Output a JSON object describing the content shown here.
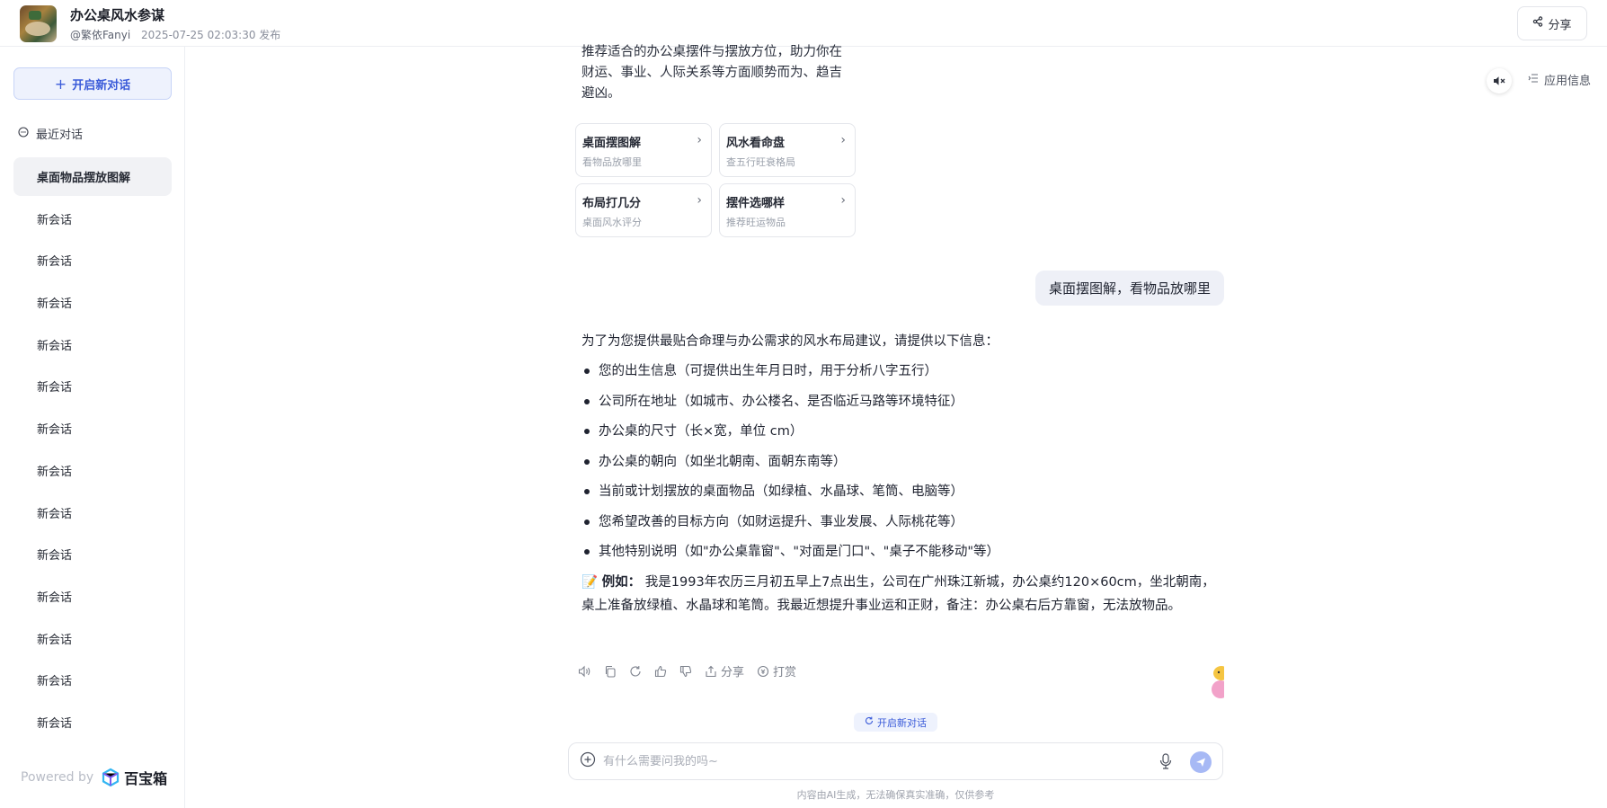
{
  "header": {
    "app_title": "办公桌风水参谋",
    "author": "@繁依Fanyi",
    "published": "2025-07-25 02:03:30 发布",
    "share_label": "分享"
  },
  "sidebar": {
    "new_chat_label": "开启新对话",
    "recent_label": "最近对话",
    "conversations": [
      {
        "label": "桌面物品摆放图解",
        "active": true
      },
      {
        "label": "新会话"
      },
      {
        "label": "新会话"
      },
      {
        "label": "新会话"
      },
      {
        "label": "新会话"
      },
      {
        "label": "新会话"
      },
      {
        "label": "新会话"
      },
      {
        "label": "新会话"
      },
      {
        "label": "新会话"
      },
      {
        "label": "新会话"
      },
      {
        "label": "新会话"
      },
      {
        "label": "新会话"
      },
      {
        "label": "新会话"
      },
      {
        "label": "新会话"
      }
    ],
    "powered_by": "Powered by",
    "brand_name": "百宝箱"
  },
  "top_right": {
    "app_info_label": "应用信息"
  },
  "chat": {
    "intro_text": "推荐适合的办公桌摆件与摆放方位，助力你在财运、事业、人际关系等方面顺势而为、趋吉避凶。",
    "quick_actions": [
      {
        "title": "桌面摆图解",
        "subtitle": "看物品放哪里"
      },
      {
        "title": "风水看命盘",
        "subtitle": "查五行旺衰格局"
      },
      {
        "title": "布局打几分",
        "subtitle": "桌面风水评分"
      },
      {
        "title": "摆件选哪样",
        "subtitle": "推荐旺运物品"
      }
    ],
    "user_message": "桌面摆图解，看物品放哪里",
    "answer": {
      "lead": "为了为您提供最贴合命理与办公需求的风水布局建议，请提供以下信息：",
      "items": [
        "您的出生信息（可提供出生年月日时，用于分析八字五行）",
        "公司所在地址（如城市、办公楼名、是否临近马路等环境特征）",
        "办公桌的尺寸（长×宽，单位 cm）",
        "办公桌的朝向（如坐北朝南、面朝东南等）",
        "当前或计划摆放的桌面物品（如绿植、水晶球、笔筒、电脑等）",
        "您希望改善的目标方向（如财运提升、事业发展、人际桃花等）",
        "其他特别说明（如\"办公桌靠窗\"、\"对面是门口\"、\"桌子不能移动\"等）"
      ],
      "example_emoji": "📝",
      "example_label": "例如：",
      "example_text": "我是1993年农历三月初五早上7点出生，公司在广州珠江新城，办公桌约120×60cm，坐北朝南，桌上准备放绿植、水晶球和笔筒。我最近想提升事业运和正财，备注：办公桌右后方靠窗，无法放物品。"
    },
    "actions": {
      "share_label": "分享",
      "tip_label": "打赏"
    },
    "new_chat_chip": "开启新对话",
    "input_placeholder": "有什么需要问我的吗~",
    "disclaimer": "内容由AI生成，无法确保真实准确，仅供参考"
  },
  "colors": {
    "accent": "#3a5bd9",
    "accent_bg": "#eef2fd",
    "user_bubble_bg": "#eef0f7"
  }
}
